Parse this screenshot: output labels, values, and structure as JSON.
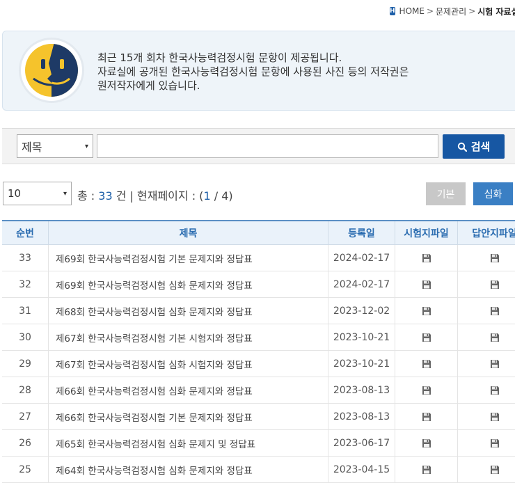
{
  "breadcrumb": {
    "home_icon": "H",
    "home": "HOME",
    "sep1": ">",
    "level1": "문제관리",
    "sep2": ">",
    "current": "시험 자료실"
  },
  "info": {
    "line1": "최근 15개 회차 한국사능력검정시험 문항이 제공됩니다.",
    "line2": "자료실에 공개된 한국사능력검정시험 문항에 사용된 사진 등의 저작권은",
    "line3": "원저작자에게 있습니다."
  },
  "search": {
    "field_selected": "제목",
    "field_chevron": "▾",
    "query": "",
    "button_label": "검색",
    "button_icon": "search-icon"
  },
  "list": {
    "page_size": "10",
    "page_size_chevron": "▾",
    "total_prefix": "총 : ",
    "total": "33",
    "total_suffix": " 건 | 현재페이지 : (",
    "current_page": "1",
    "page_sep": " / ",
    "total_pages": "4",
    "page_suffix": ")",
    "basic_label": "기본",
    "advanced_label": "심화"
  },
  "table": {
    "headers": {
      "no": "순번",
      "title": "제목",
      "date": "등록일",
      "exam_file": "시험지파일",
      "answer_file": "답안지파일"
    },
    "file_icon": "floppy-disk-icon",
    "rows": [
      {
        "no": "33",
        "title": "제69회 한국사능력검정시험 기본 문제지와 정답표",
        "date": "2024-02-17"
      },
      {
        "no": "32",
        "title": "제69회 한국사능력검정시험 심화 문제지와 정답표",
        "date": "2024-02-17"
      },
      {
        "no": "31",
        "title": "제68회 한국사능력검정시험 심화 문제지와 정답표",
        "date": "2023-12-02"
      },
      {
        "no": "30",
        "title": "제67회 한국사능력검정시험 기본 시험지와 정답표",
        "date": "2023-10-21"
      },
      {
        "no": "29",
        "title": "제67회 한국사능력검정시험 심화 시험지와 정답표",
        "date": "2023-10-21"
      },
      {
        "no": "28",
        "title": "제66회 한국사능력검정시험 심화 문제지와 정답표",
        "date": "2023-08-13"
      },
      {
        "no": "27",
        "title": "제66회 한국사능력검정시험 기본 문제지와 정답표",
        "date": "2023-08-13"
      },
      {
        "no": "26",
        "title": "제65회 한국사능력검정시험 심화 문제지 및 정답표",
        "date": "2023-06-17"
      },
      {
        "no": "25",
        "title": "제64회 한국사능력검정시험 심화 문제지와 정답표",
        "date": "2023-04-15"
      }
    ]
  },
  "colors": {
    "primary": "#1757a3",
    "accent": "#3a7fc4",
    "header_text": "#2a6cb0",
    "banner_bg": "#eef4f9",
    "mascot_yellow": "#f5c32c",
    "mascot_navy": "#1e3a66"
  }
}
